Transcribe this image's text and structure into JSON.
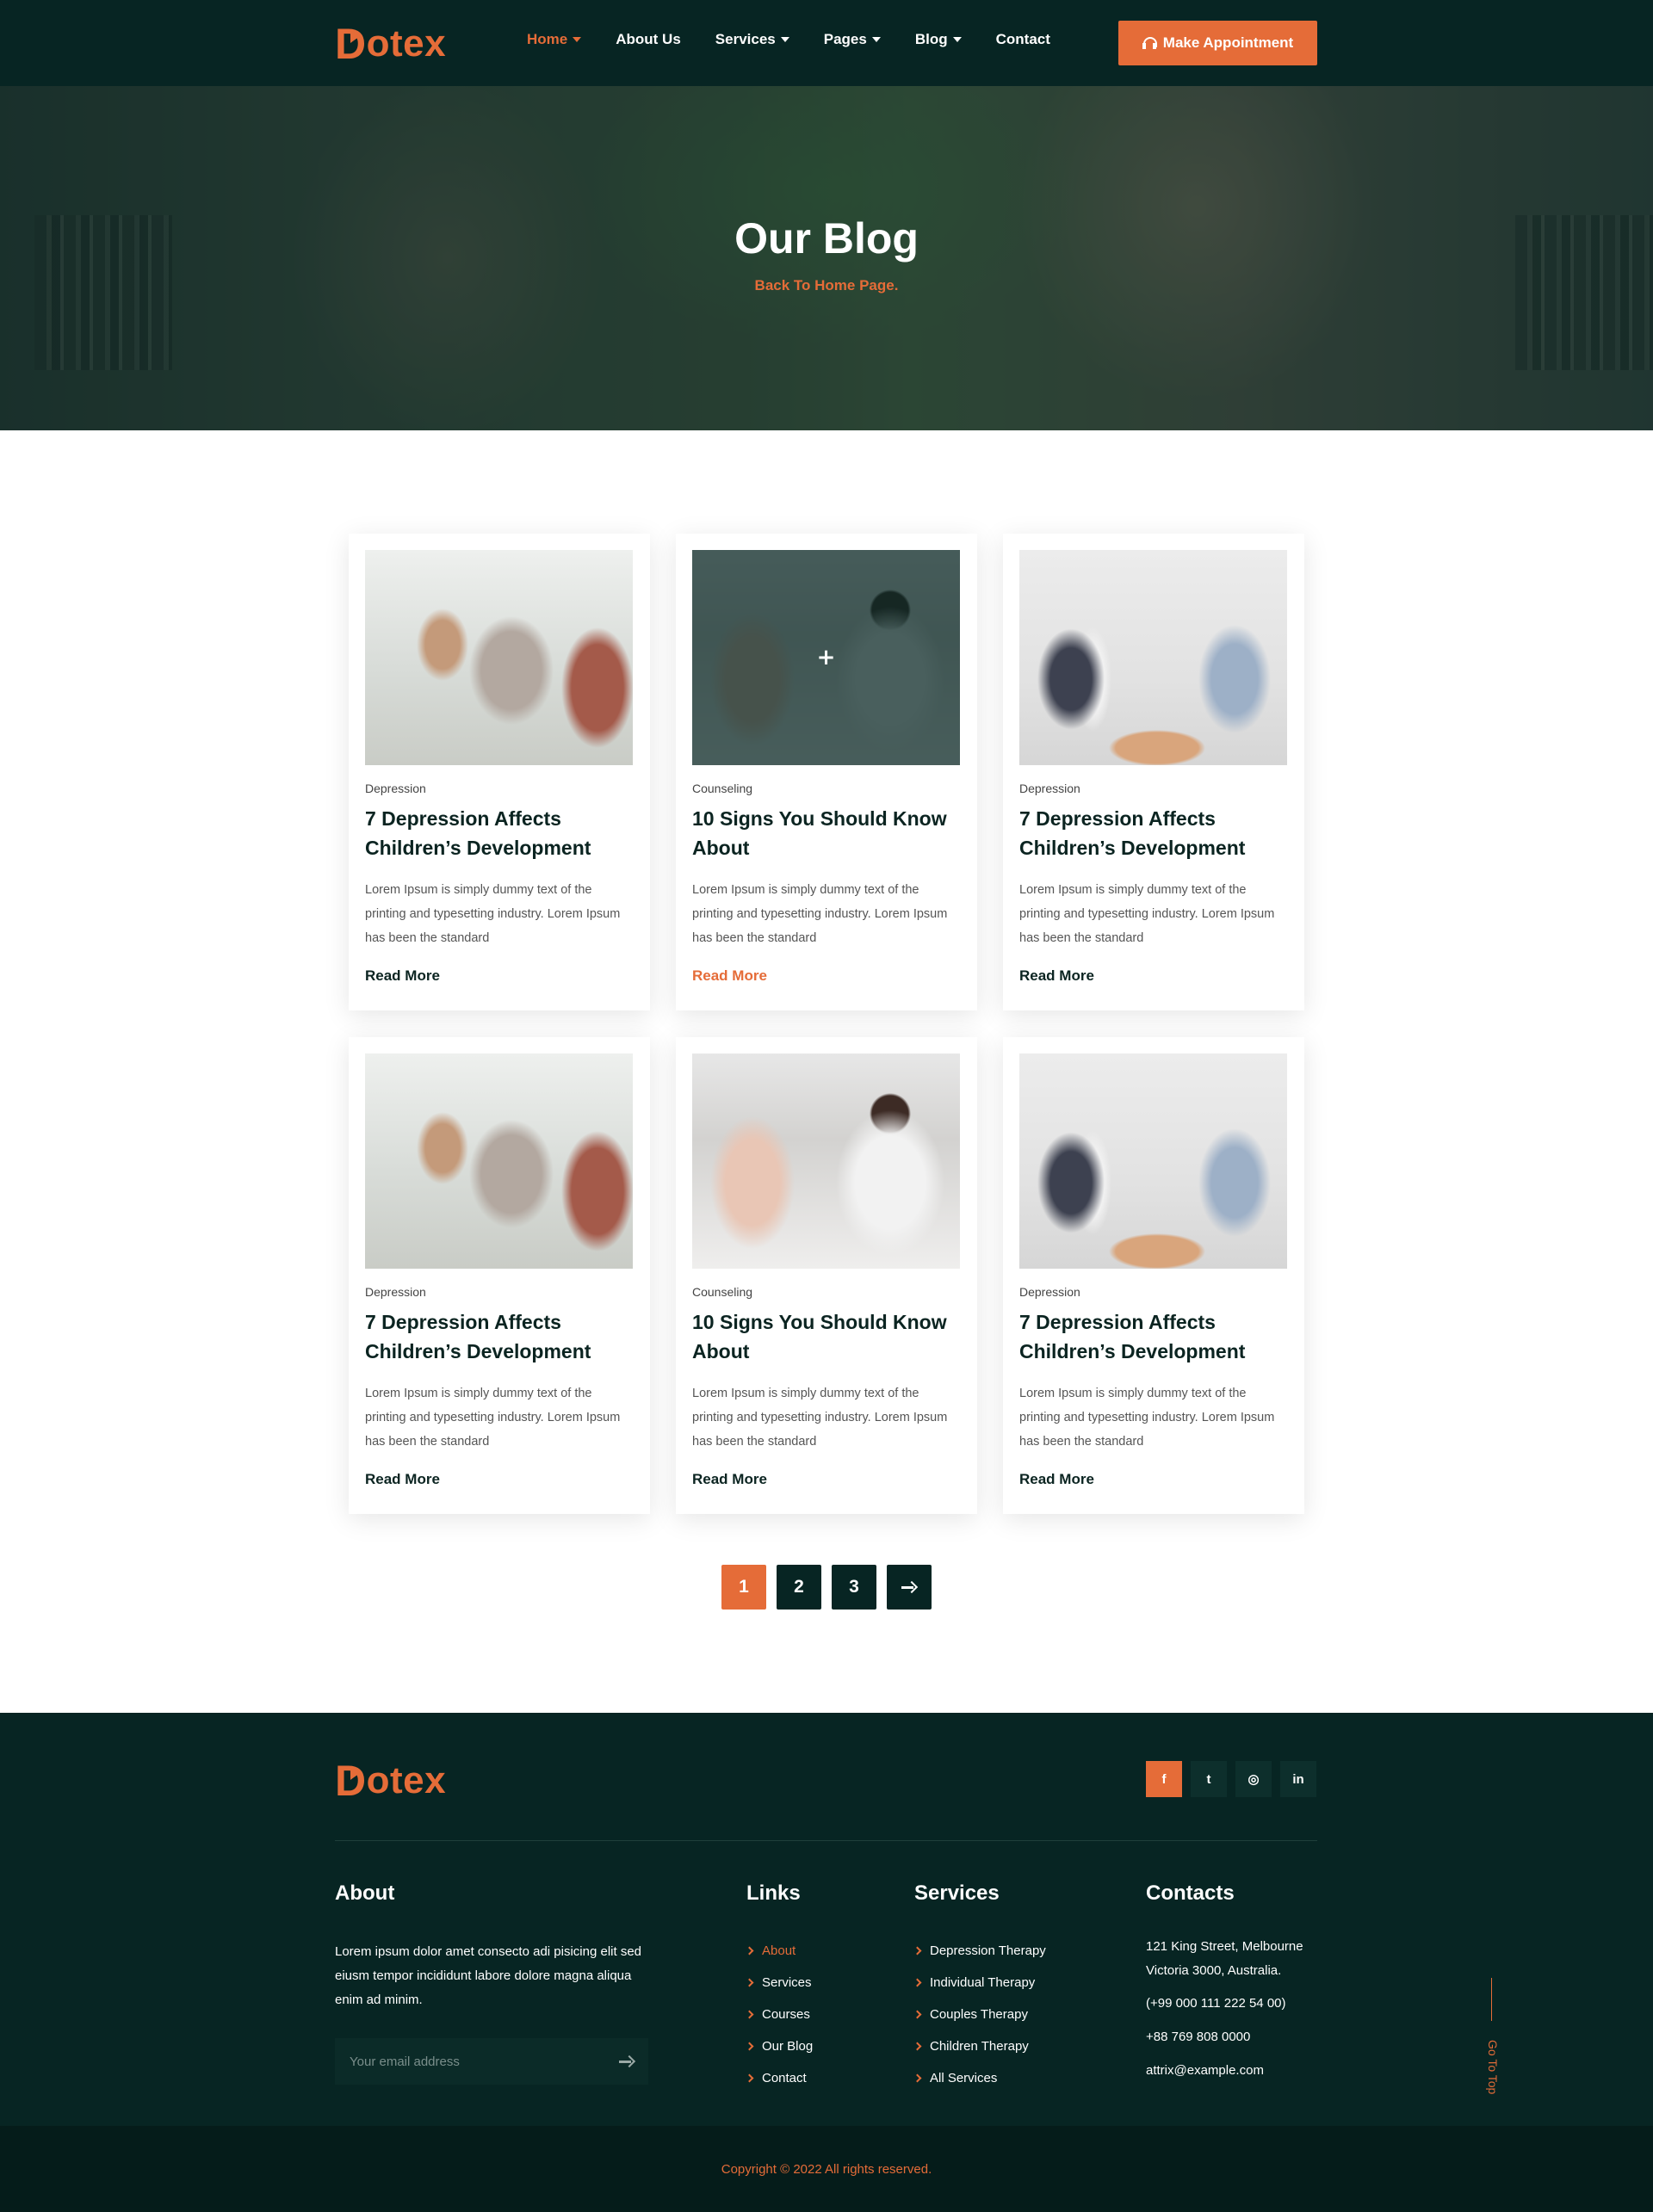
{
  "header": {
    "logo_initial": "D",
    "logo_rest": "otex",
    "nav": [
      {
        "label": "Home",
        "dropdown": true,
        "active": true
      },
      {
        "label": "About Us",
        "dropdown": false,
        "active": false
      },
      {
        "label": "Services",
        "dropdown": true,
        "active": false
      },
      {
        "label": "Pages",
        "dropdown": true,
        "active": false
      },
      {
        "label": "Blog",
        "dropdown": true,
        "active": false
      },
      {
        "label": "Contact",
        "dropdown": false,
        "active": false
      }
    ],
    "cta_label": "Make Appointment"
  },
  "hero": {
    "title": "Our Blog",
    "back_link": "Back To Home Page."
  },
  "posts": [
    {
      "category": "Depression",
      "title": "7 Depression Affects Children’s Development",
      "excerpt": "Lorem Ipsum is simply dummy text of the printing and typesetting industry. Lorem Ipsum has been the standard",
      "read_more": "Read More",
      "hovered": false
    },
    {
      "category": "Counseling",
      "title": "10 Signs You Should Know About",
      "excerpt": "Lorem Ipsum is simply dummy text of the printing and typesetting industry. Lorem Ipsum has been the standard",
      "read_more": "Read More",
      "hovered": true
    },
    {
      "category": "Depression",
      "title": "7 Depression Affects Children’s Development",
      "excerpt": "Lorem Ipsum is simply dummy text of the printing and typesetting industry. Lorem Ipsum has been the standard",
      "read_more": "Read More",
      "hovered": false
    },
    {
      "category": "Depression",
      "title": "7 Depression Affects Children’s Development",
      "excerpt": "Lorem Ipsum is simply dummy text of the printing and typesetting industry. Lorem Ipsum has been the standard",
      "read_more": "Read More",
      "hovered": false
    },
    {
      "category": "Counseling",
      "title": "10 Signs You Should Know About",
      "excerpt": "Lorem Ipsum is simply dummy text of the printing and typesetting industry. Lorem Ipsum has been the standard",
      "read_more": "Read More",
      "hovered": false
    },
    {
      "category": "Depression",
      "title": "7 Depression Affects Children’s Development",
      "excerpt": "Lorem Ipsum is simply dummy text of the printing and typesetting industry. Lorem Ipsum has been the standard",
      "read_more": "Read More",
      "hovered": false
    }
  ],
  "pagination": {
    "pages": [
      "1",
      "2",
      "3"
    ],
    "current": "1",
    "next_icon": "arrow-right-icon"
  },
  "footer": {
    "logo_initial": "D",
    "logo_rest": "otex",
    "social": [
      {
        "icon": "facebook-icon",
        "glyph": "f",
        "active": true
      },
      {
        "icon": "twitter-icon",
        "glyph": "t",
        "active": false
      },
      {
        "icon": "instagram-icon",
        "glyph": "◎",
        "active": false
      },
      {
        "icon": "linkedin-icon",
        "glyph": "in",
        "active": false
      }
    ],
    "about": {
      "heading": "About",
      "text": "Lorem ipsum dolor amet consecto adi pisicing elit sed eiusm tempor incididunt labore dolore magna aliqua enim ad minim.",
      "email_placeholder": "Your email address"
    },
    "links": {
      "heading": "Links",
      "items": [
        "About",
        "Services",
        "Courses",
        "Our Blog",
        "Contact"
      ]
    },
    "services": {
      "heading": "Services",
      "items": [
        "Depression Therapy",
        "Individual Therapy",
        "Couples Therapy",
        "Children Therapy",
        "All Services"
      ]
    },
    "contacts": {
      "heading": "Contacts",
      "address": "121 King Street, Melbourne Victoria 3000, Australia.",
      "phone1": "(+99 000 111 222 54 00)",
      "phone2": "+88 769 808 0000",
      "email": "attrix@example.com"
    },
    "go_top": "Go To Top",
    "copyright": "Copyright © 2022 All rights reserved."
  },
  "colors": {
    "dark": "#072523",
    "accent": "#e56c38"
  }
}
